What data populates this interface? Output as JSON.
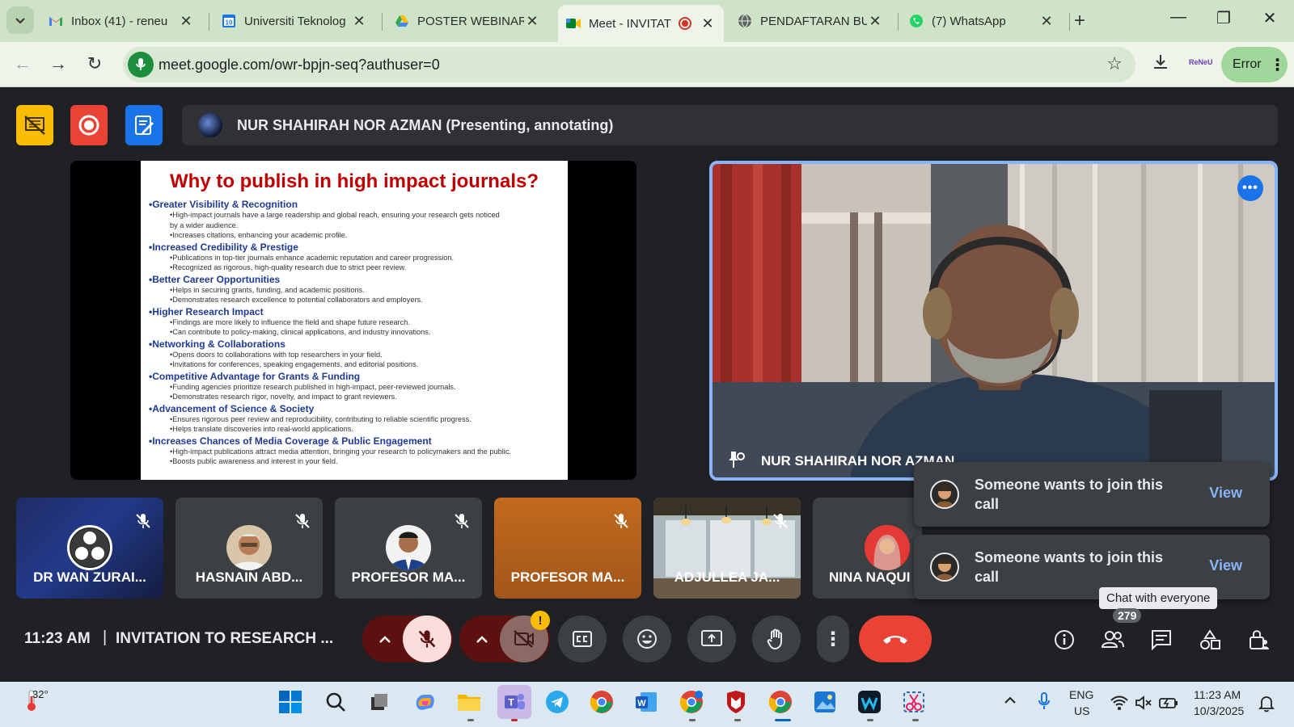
{
  "browser": {
    "tabs": [
      {
        "label": "Inbox (41) - reneu",
        "active": false
      },
      {
        "label": "Universiti Teknolog",
        "active": false
      },
      {
        "label": "POSTER WEBINAR",
        "active": false
      },
      {
        "label": "Meet - INVITAT",
        "active": true
      },
      {
        "label": "PENDAFTARAN BU",
        "active": false
      },
      {
        "label": "(7) WhatsApp",
        "active": false
      }
    ],
    "url": "meet.google.com/owr-bpjn-seq?authuser=0",
    "profile_label": "ReNeU",
    "error_label": "Error"
  },
  "meet": {
    "presenter_label": "NUR SHAHIRAH NOR AZMAN (Presenting, annotating)",
    "slide": {
      "title": "Why to publish in high impact journals?",
      "sections": [
        {
          "head": "•Greater Visibility & Recognition",
          "bullets": [
            "•High-impact journals have a large readership and global reach, ensuring your research gets noticed",
            "by a wider audience.",
            "•Increases citations, enhancing your academic profile."
          ]
        },
        {
          "head": "•Increased Credibility & Prestige",
          "bullets": [
            "•Publications in top-tier journals enhance academic reputation and career progression.",
            "•Recognized as rigorous, high-quality research due to strict peer review."
          ]
        },
        {
          "head": "•Better Career Opportunities",
          "bullets": [
            "•Helps in securing grants, funding, and academic positions.",
            "•Demonstrates research excellence to potential collaborators and employers."
          ]
        },
        {
          "head": "•Higher Research Impact",
          "bullets": [
            "•Findings are more likely to influence the field and shape future research.",
            "•Can contribute to policy-making, clinical applications, and industry innovations."
          ]
        },
        {
          "head": "•Networking & Collaborations",
          "bullets": [
            "•Opens doors to collaborations with top researchers in your field.",
            "•Invitations for conferences, speaking engagements, and editorial positions."
          ]
        },
        {
          "head": "•Competitive Advantage for Grants & Funding",
          "bullets": [
            "•Funding agencies prioritize research published in high-impact, peer-reviewed journals.",
            "•Demonstrates research rigor, novelty, and impact to grant reviewers."
          ]
        },
        {
          "head": "•Advancement of Science & Society",
          "bullets": [
            "•Ensures rigorous peer review and reproducibility, contributing to reliable scientific progress.",
            "•Helps translate discoveries into real-world applications."
          ]
        },
        {
          "head": "•Increases Chances of Media Coverage & Public Engagement",
          "bullets": [
            "•High-impact publications attract media attention, bringing your research to policymakers and the public.",
            "•Boosts public awareness and interest in your field."
          ]
        }
      ]
    },
    "main_tile_name": "NUR SHAHIRAH NOR AZMAN",
    "participants": [
      {
        "name": "DR WAN ZURAI..."
      },
      {
        "name": "HASNAIN ABD..."
      },
      {
        "name": "PROFESOR MA..."
      },
      {
        "name": "PROFESOR MA..."
      },
      {
        "name": "ADJULLEA JA..."
      },
      {
        "name": "NINA NAQUI"
      }
    ],
    "notifications": [
      {
        "text": "Someone wants to join this call",
        "action": "View"
      },
      {
        "text": "Someone wants to join this call",
        "action": "View"
      }
    ],
    "tooltip": "Chat with everyone",
    "people_count": "279",
    "clock": "11:23 AM",
    "separator": "|",
    "meeting_title": "INVITATION TO RESEARCH ...",
    "camera_warning": "!"
  },
  "taskbar": {
    "temperature": "32°",
    "lang_line1": "ENG",
    "lang_line2": "US",
    "time": "11:23 AM",
    "date": "10/3/2025"
  }
}
